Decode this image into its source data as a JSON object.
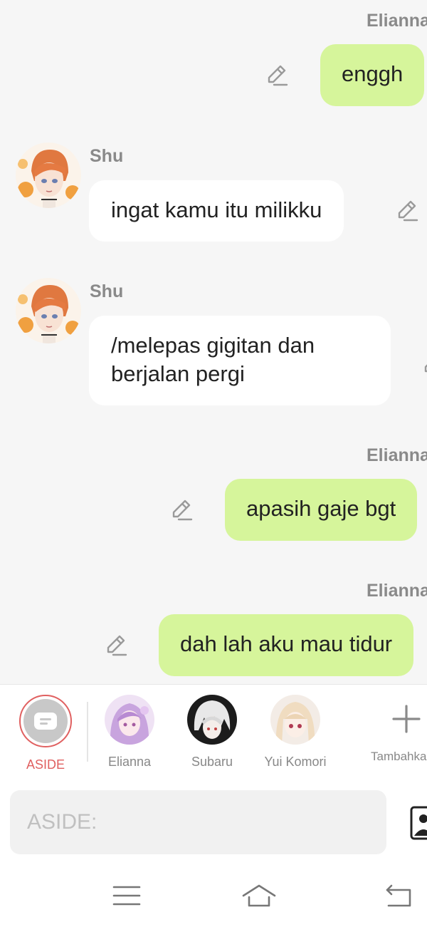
{
  "messages": [
    {
      "sender": "Elianna",
      "text": "enggh",
      "direction": "out"
    },
    {
      "sender": "Shu",
      "text": "ingat kamu itu milikku",
      "direction": "in"
    },
    {
      "sender": "Shu",
      "text": "/melepas gigitan dan berjalan pergi",
      "direction": "in"
    },
    {
      "sender": "Elianna",
      "text": "apasih gaje bgt",
      "direction": "out"
    },
    {
      "sender": "Elianna",
      "text": "dah lah aku mau tidur",
      "direction": "out"
    }
  ],
  "characters": [
    {
      "label": "ASIDE",
      "selected": true
    },
    {
      "label": "Elianna"
    },
    {
      "label": "Subaru"
    },
    {
      "label": "Yui Komori"
    },
    {
      "label": "Tambahkan",
      "icon": "plus-icon"
    }
  ],
  "input": {
    "placeholder": "ASIDE:",
    "value": ""
  },
  "colors": {
    "outgoing_bubble": "#d6f59b",
    "incoming_bubble": "#ffffff",
    "background": "#f6f6f6",
    "selected_label": "#e06060"
  },
  "icons": [
    "edit-icon",
    "chat-icon",
    "plus-icon",
    "image-icon",
    "menu-icon",
    "home-icon",
    "back-icon"
  ]
}
